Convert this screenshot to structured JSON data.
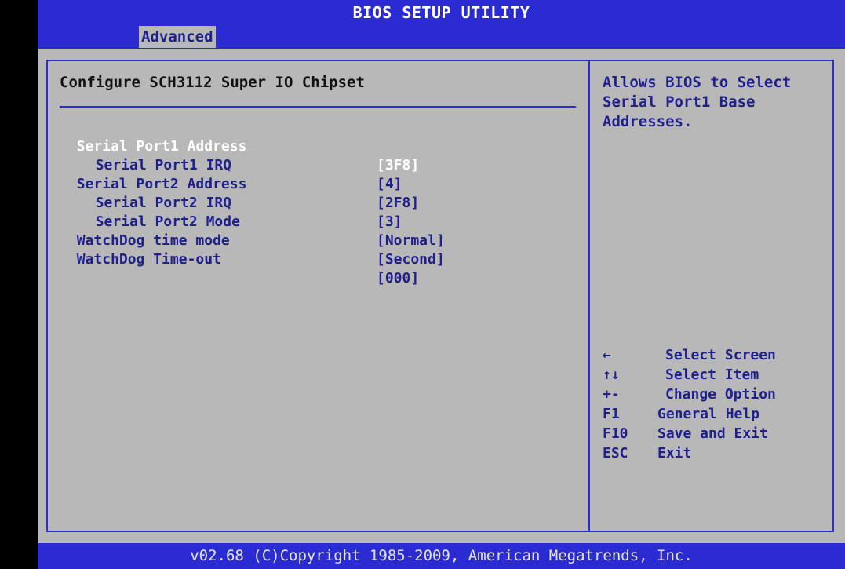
{
  "window": {
    "title": "BIOS SETUP UTILITY"
  },
  "menubar": {
    "tabs": [
      {
        "label": "Advanced",
        "active": true
      }
    ]
  },
  "main": {
    "section_title": "Configure SCH3112 Super IO Chipset",
    "settings": [
      {
        "label": "Serial Port1 Address",
        "value": "[3F8]",
        "indent": false,
        "selected": true
      },
      {
        "label": "Serial Port1 IRQ",
        "value": "[4]",
        "indent": true,
        "selected": false
      },
      {
        "label": "Serial Port2 Address",
        "value": "[2F8]",
        "indent": false,
        "selected": false
      },
      {
        "label": "Serial Port2 IRQ",
        "value": "[3]",
        "indent": true,
        "selected": false
      },
      {
        "label": "Serial Port2 Mode",
        "value": "[Normal]",
        "indent": true,
        "selected": false
      },
      {
        "label": "WatchDog time mode",
        "value": "[Second]",
        "indent": false,
        "selected": false
      },
      {
        "label": "WatchDog Time-out",
        "value": "[000]",
        "indent": false,
        "selected": false
      }
    ]
  },
  "help_panel": {
    "lines": [
      "Allows BIOS to Select",
      "Serial Port1 Base",
      "Addresses."
    ]
  },
  "key_legend": [
    {
      "key": "←",
      "description": "Select Screen"
    },
    {
      "key": "↑↓",
      "description": "Select Item"
    },
    {
      "key": "+-",
      "description": "Change Option"
    },
    {
      "key": "F1",
      "description": "General Help"
    },
    {
      "key": "F10",
      "description": "Save and Exit"
    },
    {
      "key": "ESC",
      "description": "Exit"
    }
  ],
  "footer": {
    "text": "v02.68 (C)Copyright 1985-2009, American Megatrends, Inc."
  },
  "colors": {
    "title_bar": "#2b2bd4",
    "panel_bg": "#b8b8b8",
    "text": "#1f1f8e",
    "selected_text": "#ffffff"
  }
}
